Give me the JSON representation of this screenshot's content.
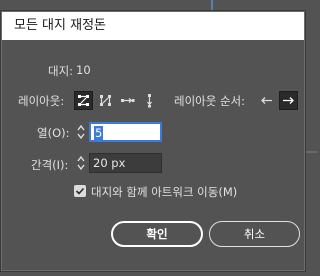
{
  "window": {
    "title": "모든 대지 재정돈"
  },
  "artboards": {
    "label": "대지:",
    "count": "10"
  },
  "layout": {
    "label": "레이아웃:",
    "options": [
      {
        "icon": "grid-by-row-icon",
        "active": true
      },
      {
        "icon": "grid-by-column-icon",
        "active": false
      },
      {
        "icon": "arrange-by-row-icon",
        "active": false
      },
      {
        "icon": "arrange-by-column-icon",
        "active": false
      }
    ]
  },
  "layout_order": {
    "label": "레이아웃 순서:",
    "options": [
      {
        "icon": "left-arrow-icon",
        "active": false
      },
      {
        "icon": "right-arrow-icon",
        "active": true
      }
    ]
  },
  "columns": {
    "label": "열(O):",
    "value": "5"
  },
  "spacing": {
    "label": "간격(I):",
    "value": "20 px"
  },
  "move_artwork": {
    "label": "대지와 함께 아트워크 이동(M)",
    "checked": true
  },
  "buttons": {
    "ok": "확인",
    "cancel": "취소"
  },
  "colors": {
    "accent": "#3d7bd8",
    "dialog_bg": "#535353"
  }
}
